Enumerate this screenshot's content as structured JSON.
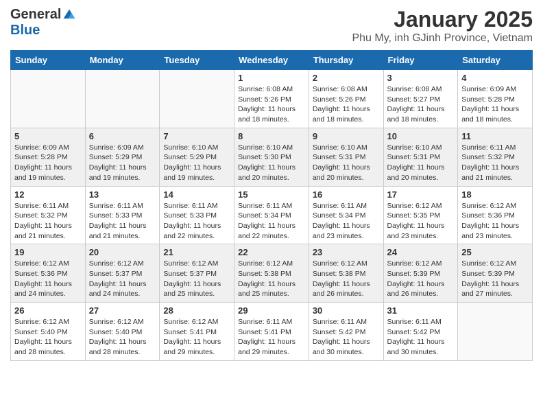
{
  "logo": {
    "general": "General",
    "blue": "Blue"
  },
  "title": "January 2025",
  "subtitle": "Phu My, inh GJinh Province, Vietnam",
  "headers": [
    "Sunday",
    "Monday",
    "Tuesday",
    "Wednesday",
    "Thursday",
    "Friday",
    "Saturday"
  ],
  "weeks": [
    [
      {
        "day": "",
        "info": ""
      },
      {
        "day": "",
        "info": ""
      },
      {
        "day": "",
        "info": ""
      },
      {
        "day": "1",
        "info": "Sunrise: 6:08 AM\nSunset: 5:26 PM\nDaylight: 11 hours and 18 minutes."
      },
      {
        "day": "2",
        "info": "Sunrise: 6:08 AM\nSunset: 5:26 PM\nDaylight: 11 hours and 18 minutes."
      },
      {
        "day": "3",
        "info": "Sunrise: 6:08 AM\nSunset: 5:27 PM\nDaylight: 11 hours and 18 minutes."
      },
      {
        "day": "4",
        "info": "Sunrise: 6:09 AM\nSunset: 5:28 PM\nDaylight: 11 hours and 18 minutes."
      }
    ],
    [
      {
        "day": "5",
        "info": "Sunrise: 6:09 AM\nSunset: 5:28 PM\nDaylight: 11 hours and 19 minutes."
      },
      {
        "day": "6",
        "info": "Sunrise: 6:09 AM\nSunset: 5:29 PM\nDaylight: 11 hours and 19 minutes."
      },
      {
        "day": "7",
        "info": "Sunrise: 6:10 AM\nSunset: 5:29 PM\nDaylight: 11 hours and 19 minutes."
      },
      {
        "day": "8",
        "info": "Sunrise: 6:10 AM\nSunset: 5:30 PM\nDaylight: 11 hours and 20 minutes."
      },
      {
        "day": "9",
        "info": "Sunrise: 6:10 AM\nSunset: 5:31 PM\nDaylight: 11 hours and 20 minutes."
      },
      {
        "day": "10",
        "info": "Sunrise: 6:10 AM\nSunset: 5:31 PM\nDaylight: 11 hours and 20 minutes."
      },
      {
        "day": "11",
        "info": "Sunrise: 6:11 AM\nSunset: 5:32 PM\nDaylight: 11 hours and 21 minutes."
      }
    ],
    [
      {
        "day": "12",
        "info": "Sunrise: 6:11 AM\nSunset: 5:32 PM\nDaylight: 11 hours and 21 minutes."
      },
      {
        "day": "13",
        "info": "Sunrise: 6:11 AM\nSunset: 5:33 PM\nDaylight: 11 hours and 21 minutes."
      },
      {
        "day": "14",
        "info": "Sunrise: 6:11 AM\nSunset: 5:33 PM\nDaylight: 11 hours and 22 minutes."
      },
      {
        "day": "15",
        "info": "Sunrise: 6:11 AM\nSunset: 5:34 PM\nDaylight: 11 hours and 22 minutes."
      },
      {
        "day": "16",
        "info": "Sunrise: 6:11 AM\nSunset: 5:34 PM\nDaylight: 11 hours and 23 minutes."
      },
      {
        "day": "17",
        "info": "Sunrise: 6:12 AM\nSunset: 5:35 PM\nDaylight: 11 hours and 23 minutes."
      },
      {
        "day": "18",
        "info": "Sunrise: 6:12 AM\nSunset: 5:36 PM\nDaylight: 11 hours and 23 minutes."
      }
    ],
    [
      {
        "day": "19",
        "info": "Sunrise: 6:12 AM\nSunset: 5:36 PM\nDaylight: 11 hours and 24 minutes."
      },
      {
        "day": "20",
        "info": "Sunrise: 6:12 AM\nSunset: 5:37 PM\nDaylight: 11 hours and 24 minutes."
      },
      {
        "day": "21",
        "info": "Sunrise: 6:12 AM\nSunset: 5:37 PM\nDaylight: 11 hours and 25 minutes."
      },
      {
        "day": "22",
        "info": "Sunrise: 6:12 AM\nSunset: 5:38 PM\nDaylight: 11 hours and 25 minutes."
      },
      {
        "day": "23",
        "info": "Sunrise: 6:12 AM\nSunset: 5:38 PM\nDaylight: 11 hours and 26 minutes."
      },
      {
        "day": "24",
        "info": "Sunrise: 6:12 AM\nSunset: 5:39 PM\nDaylight: 11 hours and 26 minutes."
      },
      {
        "day": "25",
        "info": "Sunrise: 6:12 AM\nSunset: 5:39 PM\nDaylight: 11 hours and 27 minutes."
      }
    ],
    [
      {
        "day": "26",
        "info": "Sunrise: 6:12 AM\nSunset: 5:40 PM\nDaylight: 11 hours and 28 minutes."
      },
      {
        "day": "27",
        "info": "Sunrise: 6:12 AM\nSunset: 5:40 PM\nDaylight: 11 hours and 28 minutes."
      },
      {
        "day": "28",
        "info": "Sunrise: 6:12 AM\nSunset: 5:41 PM\nDaylight: 11 hours and 29 minutes."
      },
      {
        "day": "29",
        "info": "Sunrise: 6:11 AM\nSunset: 5:41 PM\nDaylight: 11 hours and 29 minutes."
      },
      {
        "day": "30",
        "info": "Sunrise: 6:11 AM\nSunset: 5:42 PM\nDaylight: 11 hours and 30 minutes."
      },
      {
        "day": "31",
        "info": "Sunrise: 6:11 AM\nSunset: 5:42 PM\nDaylight: 11 hours and 30 minutes."
      },
      {
        "day": "",
        "info": ""
      }
    ]
  ]
}
